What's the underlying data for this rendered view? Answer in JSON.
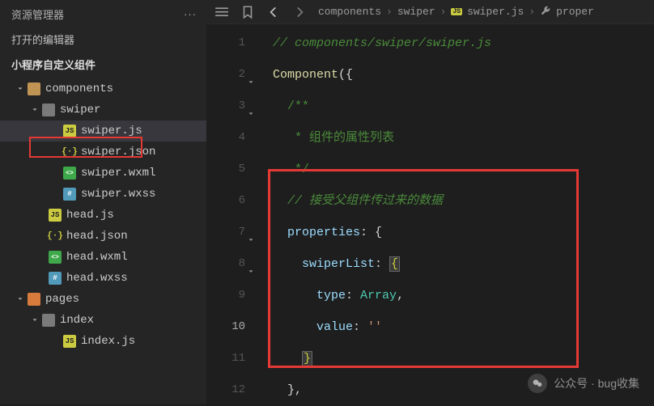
{
  "sidebar": {
    "title": "资源管理器",
    "open_editors": "打开的编辑器",
    "project": "小程序自定义组件",
    "tree": [
      {
        "label": "components",
        "indent": 18,
        "chev": true,
        "icon": "folder"
      },
      {
        "label": "swiper",
        "indent": 36,
        "chev": true,
        "icon": "folder-dark"
      },
      {
        "label": "swiper.js",
        "indent": 62,
        "chev": false,
        "icon": "js",
        "selected": true
      },
      {
        "label": "swiper.json",
        "indent": 62,
        "chev": false,
        "icon": "json"
      },
      {
        "label": "swiper.wxml",
        "indent": 62,
        "chev": false,
        "icon": "wxml"
      },
      {
        "label": "swiper.wxss",
        "indent": 62,
        "chev": false,
        "icon": "wxss"
      },
      {
        "label": "head.js",
        "indent": 44,
        "chev": false,
        "icon": "js"
      },
      {
        "label": "head.json",
        "indent": 44,
        "chev": false,
        "icon": "json"
      },
      {
        "label": "head.wxml",
        "indent": 44,
        "chev": false,
        "icon": "wxml"
      },
      {
        "label": "head.wxss",
        "indent": 44,
        "chev": false,
        "icon": "wxss"
      },
      {
        "label": "pages",
        "indent": 18,
        "chev": true,
        "icon": "folder-orange"
      },
      {
        "label": "index",
        "indent": 36,
        "chev": true,
        "icon": "folder-dark"
      },
      {
        "label": "index.js",
        "indent": 62,
        "chev": false,
        "icon": "js"
      }
    ]
  },
  "breadcrumb": {
    "parts": [
      "components",
      "swiper",
      "swiper.js",
      "proper"
    ],
    "js_badge": "JS"
  },
  "code": {
    "lines": [
      {
        "num": "1",
        "fold": "",
        "html": "<span class='c-comment'>// components/swiper/swiper.js</span>"
      },
      {
        "num": "2",
        "fold": "v",
        "html": "<span class='c-fn'>Component</span><span class='c-punc'>({</span>"
      },
      {
        "num": "3",
        "fold": "v",
        "html": "  <span class='c-doc'>/**</span>"
      },
      {
        "num": "4",
        "fold": "",
        "html": "   <span class='c-doc'>* 组件的属性列表</span>"
      },
      {
        "num": "5",
        "fold": "",
        "html": "   <span class='c-doc'>*/</span>"
      },
      {
        "num": "6",
        "fold": "",
        "html": "  <span class='c-comment'>// 接受父组件传过来的数据</span>"
      },
      {
        "num": "7",
        "fold": "v",
        "html": "  <span class='c-id'>properties</span><span class='c-punc'>: {</span>"
      },
      {
        "num": "8",
        "fold": "v",
        "html": "    <span class='c-id'>swiperList</span><span class='c-punc'>: </span><span class='c-brace hl-brace'>{</span>"
      },
      {
        "num": "9",
        "fold": "",
        "html": "      <span class='c-id'>type</span><span class='c-punc'>: </span><span class='c-type'>Array</span><span class='c-punc'>,</span>"
      },
      {
        "num": "10",
        "fold": "",
        "html": "      <span class='c-id'>value</span><span class='c-punc'>: </span><span class='c-str'>''</span>",
        "active": true
      },
      {
        "num": "11",
        "fold": "",
        "html": "    <span class='c-brace hl-brace'>}</span>"
      },
      {
        "num": "12",
        "fold": "",
        "html": "  <span class='c-punc'>},</span>"
      }
    ]
  },
  "icons": {
    "json_glyph": "{·}"
  },
  "watermark": "公众号 · bug收集"
}
